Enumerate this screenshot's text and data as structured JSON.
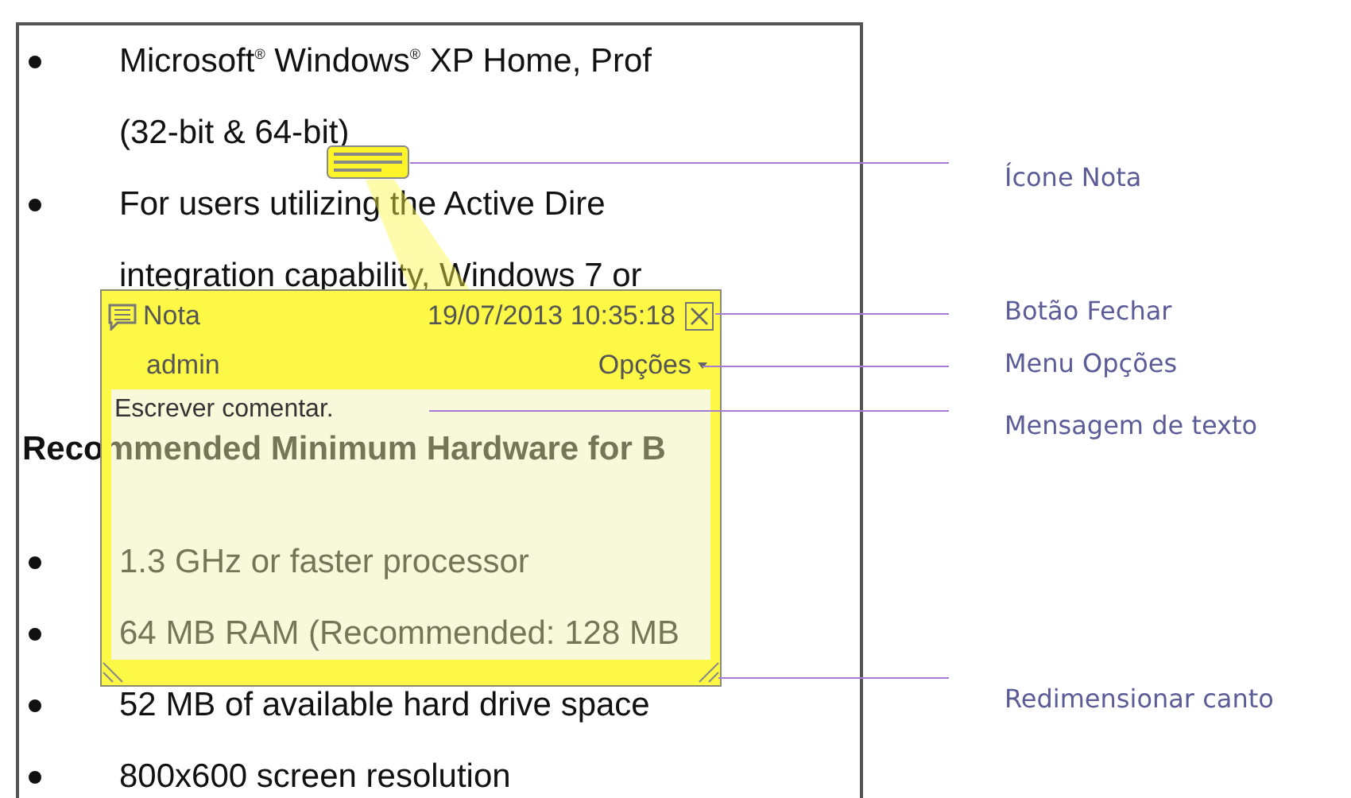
{
  "document": {
    "lines": [
      {
        "kind": "bullet",
        "text": "Microsoft$^{®}$ Windows$^{®}$ XP Home, Prof"
      },
      {
        "kind": "continuation",
        "text": "(32-bit & 64-bit)"
      },
      {
        "kind": "bullet",
        "text": "For users utilizing the Active Dire"
      },
      {
        "kind": "continuation",
        "text": "integration capability, Windows 7 or"
      },
      {
        "kind": "heading",
        "text": "Recommended Minimum Hardware for B"
      },
      {
        "kind": "bullet",
        "text": "1.3 GHz or faster processor"
      },
      {
        "kind": "bullet",
        "text": "64 MB RAM (Recommended: 128 MB"
      },
      {
        "kind": "bullet",
        "text": "52 MB of available hard drive space"
      },
      {
        "kind": "bullet",
        "text": "800x600 screen resolution"
      }
    ]
  },
  "note": {
    "title": "Nota",
    "timestamp": "19/07/2013 10:35:18",
    "author": "admin",
    "options_menu": "Opções",
    "comment": {
      "placeholder": "Escrever comentar."
    }
  },
  "callouts": [
    {
      "label": "Ícone Nota"
    },
    {
      "label": "Botão Fechar"
    },
    {
      "label": "Menu Opções"
    },
    {
      "label": "Mensagem de texto"
    },
    {
      "label": "Redimensionar canto"
    }
  ]
}
